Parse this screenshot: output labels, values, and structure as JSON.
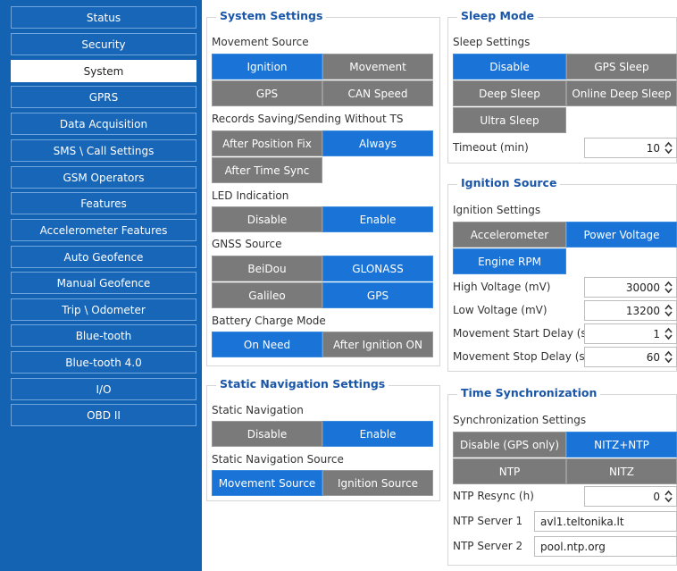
{
  "sidebar": {
    "items": [
      {
        "label": "Status"
      },
      {
        "label": "Security"
      },
      {
        "label": "System",
        "active": true
      },
      {
        "label": "GPRS"
      },
      {
        "label": "Data Acquisition"
      },
      {
        "label": "SMS \\ Call Settings"
      },
      {
        "label": "GSM Operators"
      },
      {
        "label": "Features"
      },
      {
        "label": "Accelerometer Features"
      },
      {
        "label": "Auto Geofence"
      },
      {
        "label": "Manual Geofence"
      },
      {
        "label": "Trip \\ Odometer"
      },
      {
        "label": "Blue-tooth"
      },
      {
        "label": "Blue-tooth 4.0"
      },
      {
        "label": "I/O"
      },
      {
        "label": "OBD II"
      }
    ]
  },
  "system_settings": {
    "title": "System Settings",
    "movement_source": {
      "label": "Movement Source",
      "options": [
        "Ignition",
        "Movement",
        "GPS",
        "CAN Speed"
      ],
      "selected": "Ignition"
    },
    "records": {
      "label": "Records Saving/Sending Without TS",
      "options": [
        "After Position Fix",
        "Always",
        "After Time Sync"
      ],
      "selected": "Always"
    },
    "led": {
      "label": "LED Indication",
      "options": [
        "Disable",
        "Enable"
      ],
      "selected": "Enable"
    },
    "gnss": {
      "label": "GNSS Source",
      "options": [
        "BeiDou",
        "GLONASS",
        "Galileo",
        "GPS"
      ],
      "selected": [
        "GLONASS",
        "GPS"
      ]
    },
    "battery": {
      "label": "Battery Charge Mode",
      "options": [
        "On Need",
        "After Ignition ON"
      ],
      "selected": "On Need"
    }
  },
  "static_navigation": {
    "title": "Static Navigation Settings",
    "static_nav": {
      "label": "Static Navigation",
      "options": [
        "Disable",
        "Enable"
      ],
      "selected": "Enable"
    },
    "source": {
      "label": "Static Navigation Source",
      "options": [
        "Movement Source",
        "Ignition Source"
      ],
      "selected": "Movement Source"
    }
  },
  "sleep_mode": {
    "title": "Sleep Mode",
    "settings_label": "Sleep Settings",
    "options": [
      "Disable",
      "GPS Sleep",
      "Deep Sleep",
      "Online Deep Sleep",
      "Ultra Sleep"
    ],
    "selected": "Disable",
    "timeout": {
      "label": "Timeout (min)",
      "value": "10"
    }
  },
  "ignition_source": {
    "title": "Ignition Source",
    "settings_label": "Ignition Settings",
    "options": [
      "Accelerometer",
      "Power Voltage",
      "Engine RPM"
    ],
    "selected": [
      "Power Voltage",
      "Engine RPM"
    ],
    "high_voltage": {
      "label": "High Voltage (mV)",
      "value": "30000"
    },
    "low_voltage": {
      "label": "Low Voltage (mV)",
      "value": "13200"
    },
    "start_delay": {
      "label": "Movement Start Delay (s)",
      "value": "1"
    },
    "stop_delay": {
      "label": "Movement Stop Delay (s)",
      "value": "60"
    }
  },
  "time_sync": {
    "title": "Time Synchronization",
    "settings_label": "Synchronization Settings",
    "options": [
      "Disable (GPS only)",
      "NITZ+NTP",
      "NTP",
      "NITZ"
    ],
    "selected": "NITZ+NTP",
    "resync": {
      "label": "NTP Resync (h)",
      "value": "0"
    },
    "server1": {
      "label": "NTP Server 1",
      "value": "avl1.teltonika.lt"
    },
    "server2": {
      "label": "NTP Server 2",
      "value": "pool.ntp.org"
    }
  },
  "colors": {
    "sidebar_bg": "#1463b3",
    "selected_button": "#1a73d6",
    "unselected_button": "#7a7a7a",
    "group_title": "#1a56a8"
  }
}
